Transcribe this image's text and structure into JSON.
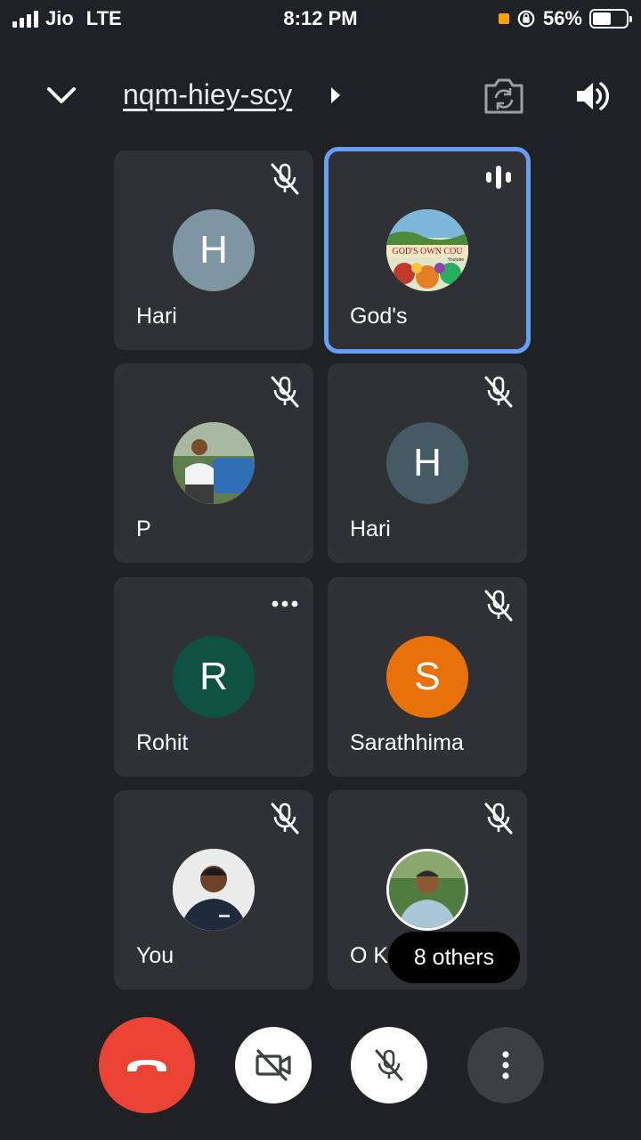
{
  "status_bar": {
    "carrier": "Jio",
    "network": "LTE",
    "time": "8:12 PM",
    "battery": "56%",
    "battery_level": 0.56
  },
  "header": {
    "meeting_code": "nqm-hiey-scy"
  },
  "participants": [
    {
      "name": "Hari",
      "initial": "H",
      "avatar_color": "#7e95a2",
      "state": "muted"
    },
    {
      "name": "God's",
      "initial": "",
      "state": "speaking",
      "active": true
    },
    {
      "name": "P",
      "initial": "",
      "state": "muted"
    },
    {
      "name": "Hari",
      "initial": "H",
      "avatar_color": "#455a64",
      "state": "muted"
    },
    {
      "name": "Rohit",
      "initial": "R",
      "avatar_color": "#0d5243",
      "state": "more-options"
    },
    {
      "name": "Sarathhima",
      "initial": "S",
      "avatar_color": "#e8710a",
      "state": "muted"
    },
    {
      "name": "You",
      "initial": "",
      "state": "muted"
    },
    {
      "name": "O K",
      "initial": "",
      "state": "muted"
    }
  ],
  "others_count_label": "8 others",
  "avatar_banner_text": "GOD'S OWN COU",
  "avatar_banner_subtext": "Youtube",
  "colors": {
    "background": "#202124",
    "tile": "#303134",
    "active_outline": "#669df6",
    "end_call": "#ea4335"
  },
  "icons": {
    "collapse": "chevron-down-icon",
    "arrow": "caret-right-icon",
    "camera_flip": "camera-flip-icon",
    "speaker": "speaker-icon",
    "mic_off": "mic-off-icon",
    "speaking": "audio-wave-icon",
    "more": "more-horizontal-icon",
    "end_call": "phone-hangup-icon",
    "cam_off": "camera-off-icon",
    "more_vert": "more-vertical-icon"
  }
}
